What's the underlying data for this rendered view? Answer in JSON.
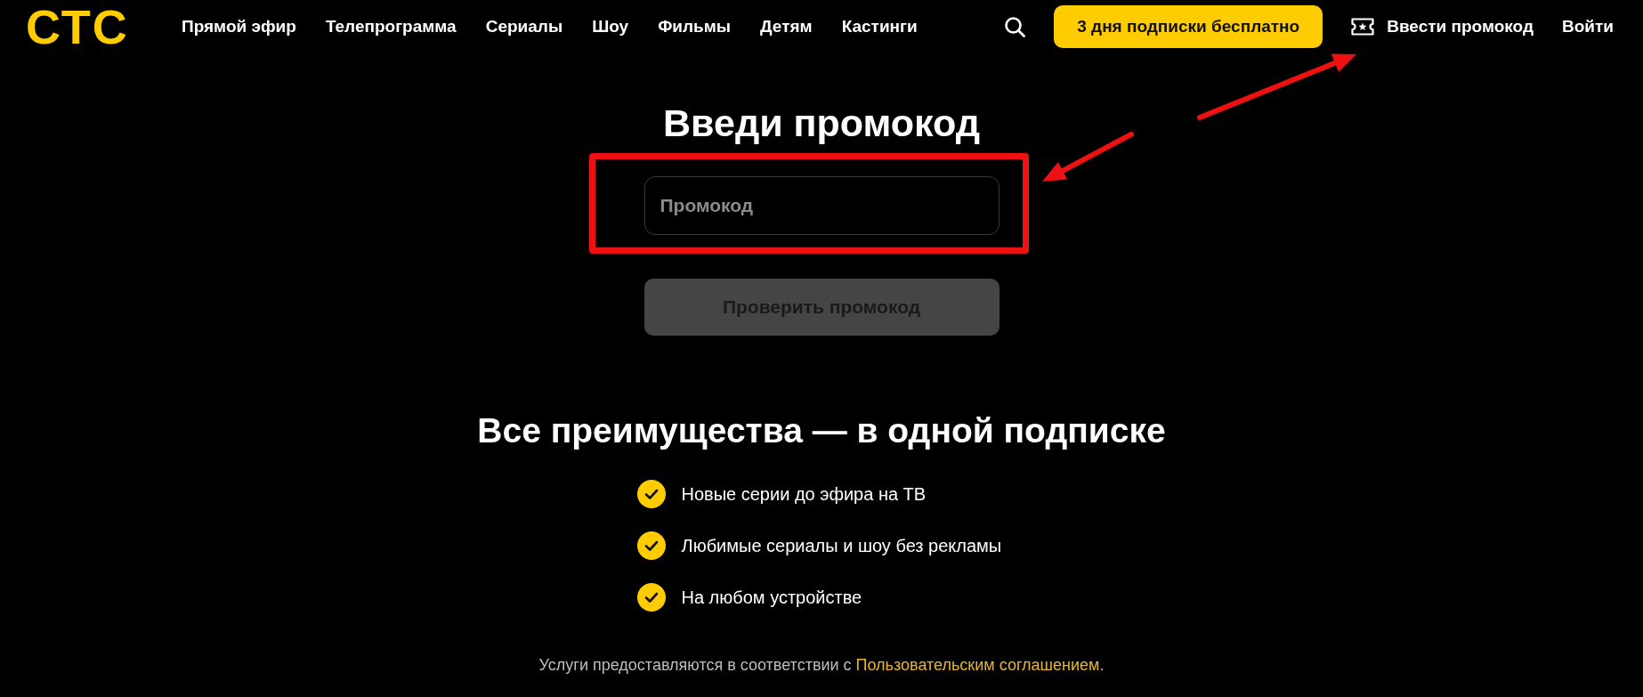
{
  "header": {
    "logo": "СТС",
    "nav": [
      "Прямой эфир",
      "Телепрограмма",
      "Сериалы",
      "Шоу",
      "Фильмы",
      "Детям",
      "Кастинги"
    ],
    "cta": "3 дня подписки бесплатно",
    "promo_link": "Ввести промокод",
    "login": "Войти"
  },
  "promo": {
    "title": "Введи промокод",
    "field": {
      "placeholder": "Промокод"
    },
    "submit": {
      "label": "Проверить промокод",
      "disabled": true
    }
  },
  "benefits": {
    "title": "Все преимущества — в одной подписке",
    "items": [
      "Новые серии до эфира на ТВ",
      "Любимые сериалы и шоу без рекламы",
      "На любом устройстве"
    ]
  },
  "footer": {
    "text": "Услуги предоставляются в соответствии с",
    "link": "Пользовательским соглашением."
  }
}
